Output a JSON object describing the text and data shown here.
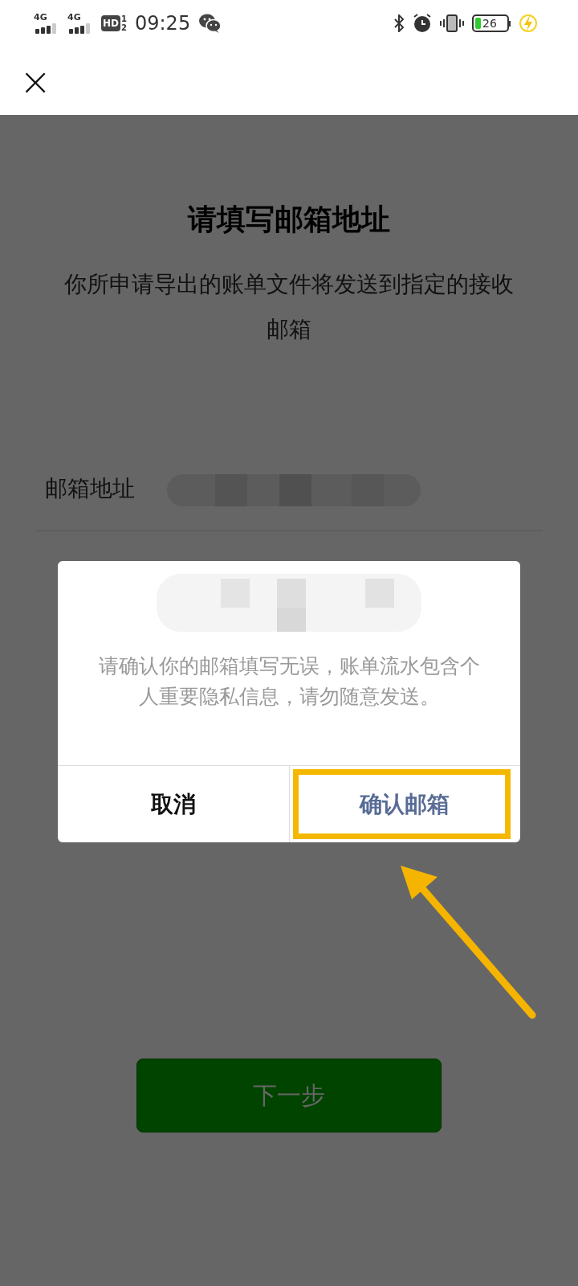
{
  "status_bar": {
    "sim_1": "4G",
    "sim_2": "4G",
    "hd_badge": "HD",
    "hd_slot_1": "1",
    "hd_slot_2": "2",
    "time": "09:25",
    "battery": "26",
    "charging": true
  },
  "header": {
    "close": "×"
  },
  "page": {
    "title": "请填写邮箱地址",
    "description": "你所申请导出的账单文件将发送到指定的接收邮箱",
    "field_label": "邮箱地址",
    "field_redacted": true,
    "next_button": "下一步"
  },
  "dialog": {
    "message": "请确认你的邮箱填写无误，账单流水包含个人重要隐私信息，请勿随意发送。",
    "redacted": true,
    "buttons": [
      {
        "label": "取消",
        "kind": "cancel",
        "highlighted": false
      },
      {
        "label": "确认邮箱",
        "kind": "confirm",
        "highlighted": true
      }
    ]
  }
}
